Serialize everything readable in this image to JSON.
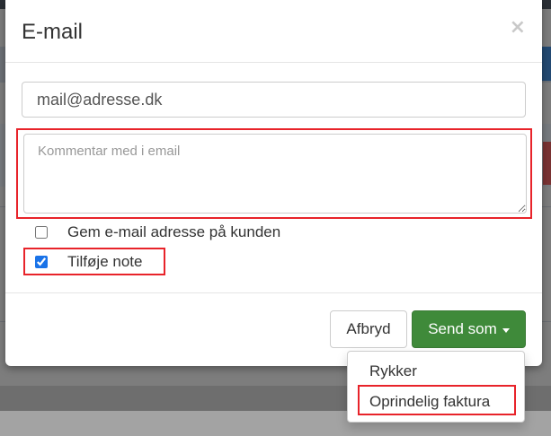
{
  "modal": {
    "title": "E-mail",
    "close_glyph": "×"
  },
  "email_input": {
    "value": "mail@adresse.dk"
  },
  "comment": {
    "placeholder": "Kommentar med i email"
  },
  "checkboxes": [
    {
      "label": "Gem e-mail adresse på kunden",
      "checked": false
    },
    {
      "label": "Tilføje note",
      "checked": true
    }
  ],
  "footer": {
    "cancel_label": "Afbryd",
    "send_label": "Send som"
  },
  "dropdown": {
    "items": [
      {
        "label": "Rykker"
      },
      {
        "label": "Oprindelig faktura"
      }
    ]
  },
  "colors": {
    "primary_green": "#3f8a3a",
    "highlight_red": "#e8232a",
    "checkbox_blue": "#1a73e8"
  },
  "icons": {
    "close": "close-icon",
    "caret": "caret-down-icon"
  }
}
